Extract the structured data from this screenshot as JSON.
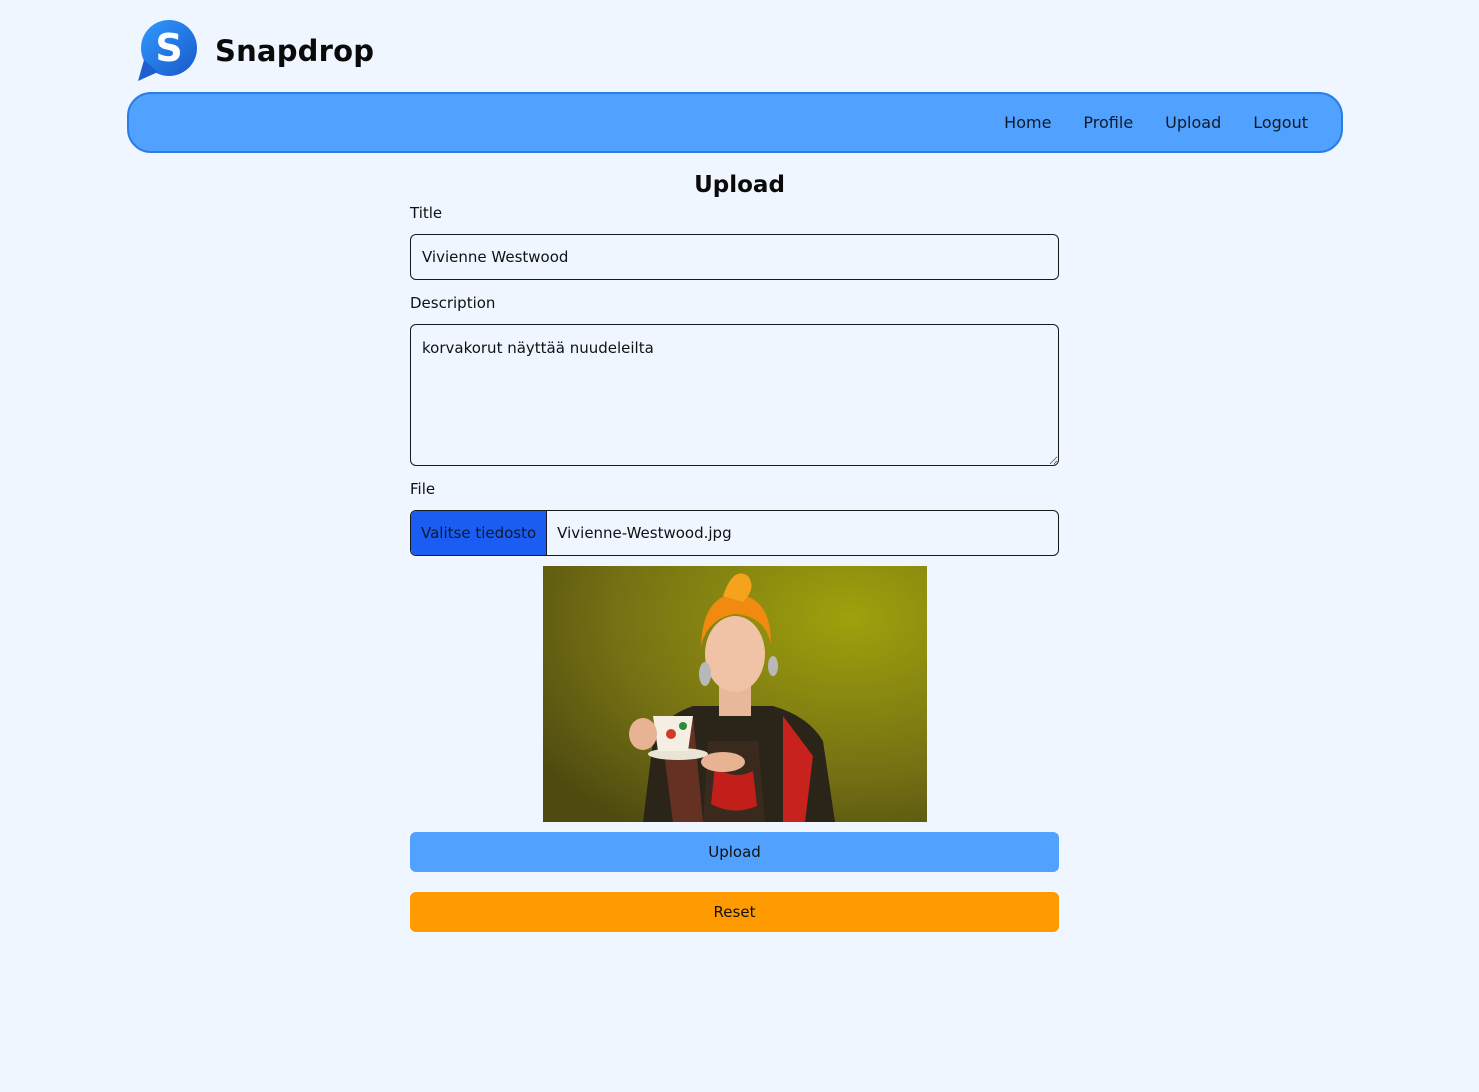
{
  "app": {
    "brand": "Snapdrop",
    "logo_icon": "speech-bubble-s-icon",
    "accent_color": "#51a2ff"
  },
  "nav": {
    "items": [
      {
        "label": "Home"
      },
      {
        "label": "Profile"
      },
      {
        "label": "Upload"
      },
      {
        "label": "Logout"
      }
    ]
  },
  "page": {
    "title": "Upload"
  },
  "form": {
    "title_label": "Title",
    "title_value": "Vivienne Westwood",
    "description_label": "Description",
    "description_value": "korvakorut näyttää nuudeleilta",
    "file_label": "File",
    "file_button_label": "Valitse tiedosto",
    "file_name": "Vivienne-Westwood.jpg",
    "preview_alt": "image-preview",
    "upload_label": "Upload",
    "reset_label": "Reset",
    "upload_color": "#51a2ff",
    "reset_color": "#ff9a00"
  }
}
